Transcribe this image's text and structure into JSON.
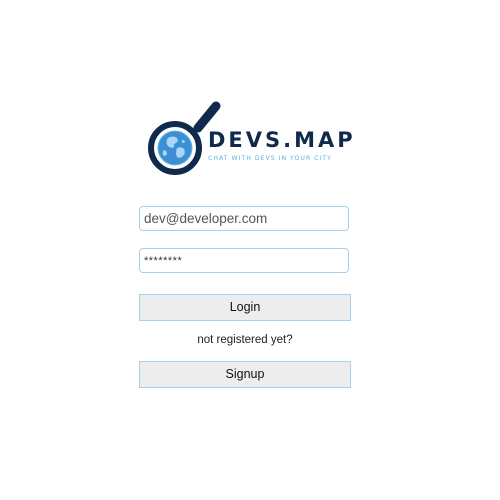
{
  "logo": {
    "title": "DEVS.MAP",
    "tagline": "CHAT WITH DEVS IN YOUR CITY",
    "icon": "magnifier-globe-icon",
    "colors": {
      "dark": "#0f2a4d",
      "accent": "#5fb0de",
      "globe": "#3d8fd4"
    }
  },
  "login_form": {
    "email_value": "dev@developer.com",
    "password_value": "********",
    "login_label": "Login",
    "not_registered_text": "not registered yet?",
    "signup_label": "Signup"
  },
  "colors": {
    "field_border": "#a9d2e8",
    "button_bg": "#ededed"
  }
}
